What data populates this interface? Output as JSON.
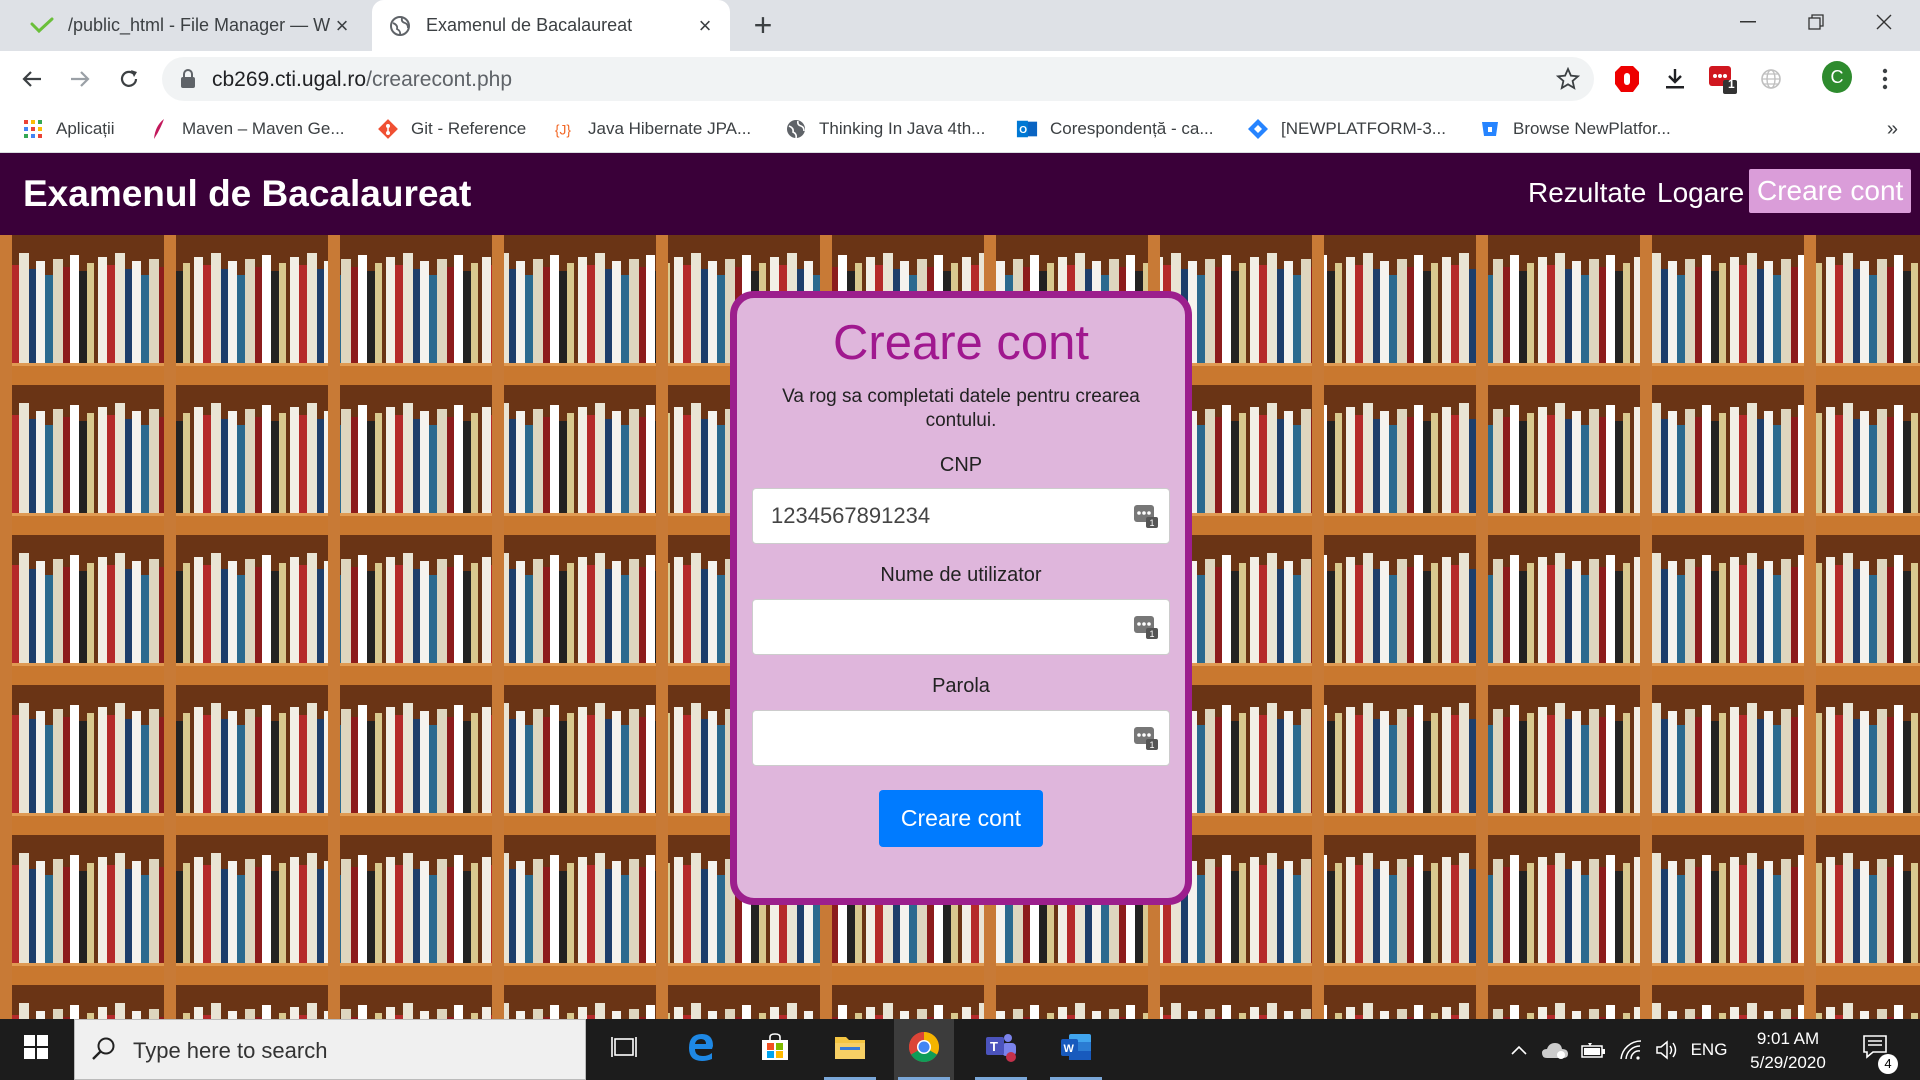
{
  "browser": {
    "tabs": [
      {
        "title": "/public_html - File Manager — W",
        "state": "inactive"
      },
      {
        "title": "Examenul de Bacalaureat",
        "state": "active"
      }
    ],
    "omnibox": {
      "host": "cb269.cti.ugal.ro",
      "path": "/crearecont.php"
    },
    "bookmarks": [
      {
        "label": "Aplicații",
        "icon": "apps-grid-icon"
      },
      {
        "label": "Maven – Maven Ge...",
        "icon": "maven-feather-icon"
      },
      {
        "label": "Git - Reference",
        "icon": "git-icon"
      },
      {
        "label": "Java Hibernate JPA...",
        "icon": "javatpoint-icon"
      },
      {
        "label": "Thinking In Java 4th...",
        "icon": "globe-icon"
      },
      {
        "label": "Corespondență - ca...",
        "icon": "outlook-icon"
      },
      {
        "label": "[NEWPLATFORM-3...",
        "icon": "jira-icon"
      },
      {
        "label": "Browse NewPlatfor...",
        "icon": "bitbucket-icon"
      }
    ],
    "profile_initial": "C",
    "extension_badge": "1"
  },
  "site": {
    "brand": "Examenul de Bacalaureat",
    "nav": [
      {
        "label": "Rezultate",
        "active": false
      },
      {
        "label": "Logare",
        "active": false
      },
      {
        "label": "Creare cont",
        "active": true
      }
    ]
  },
  "form": {
    "title": "Creare cont",
    "subtitle": "Va rog sa completati datele pentru crearea contului.",
    "fields": [
      {
        "label": "CNP",
        "value": "1234567891234"
      },
      {
        "label": "Nume de utilizator",
        "value": ""
      },
      {
        "label": "Parola",
        "value": ""
      }
    ],
    "submit_label": "Creare cont"
  },
  "taskbar": {
    "search_placeholder": "Type here to search",
    "language": "ENG",
    "time": "9:01 AM",
    "date": "5/29/2020",
    "notification_count": "4"
  },
  "colors": {
    "navbar": "#3a0039",
    "nav_active": "#da9dd9",
    "card_bg": "#dfb6dc",
    "card_border": "#9c1f8d",
    "title": "#a0188f",
    "button": "#007bff"
  }
}
